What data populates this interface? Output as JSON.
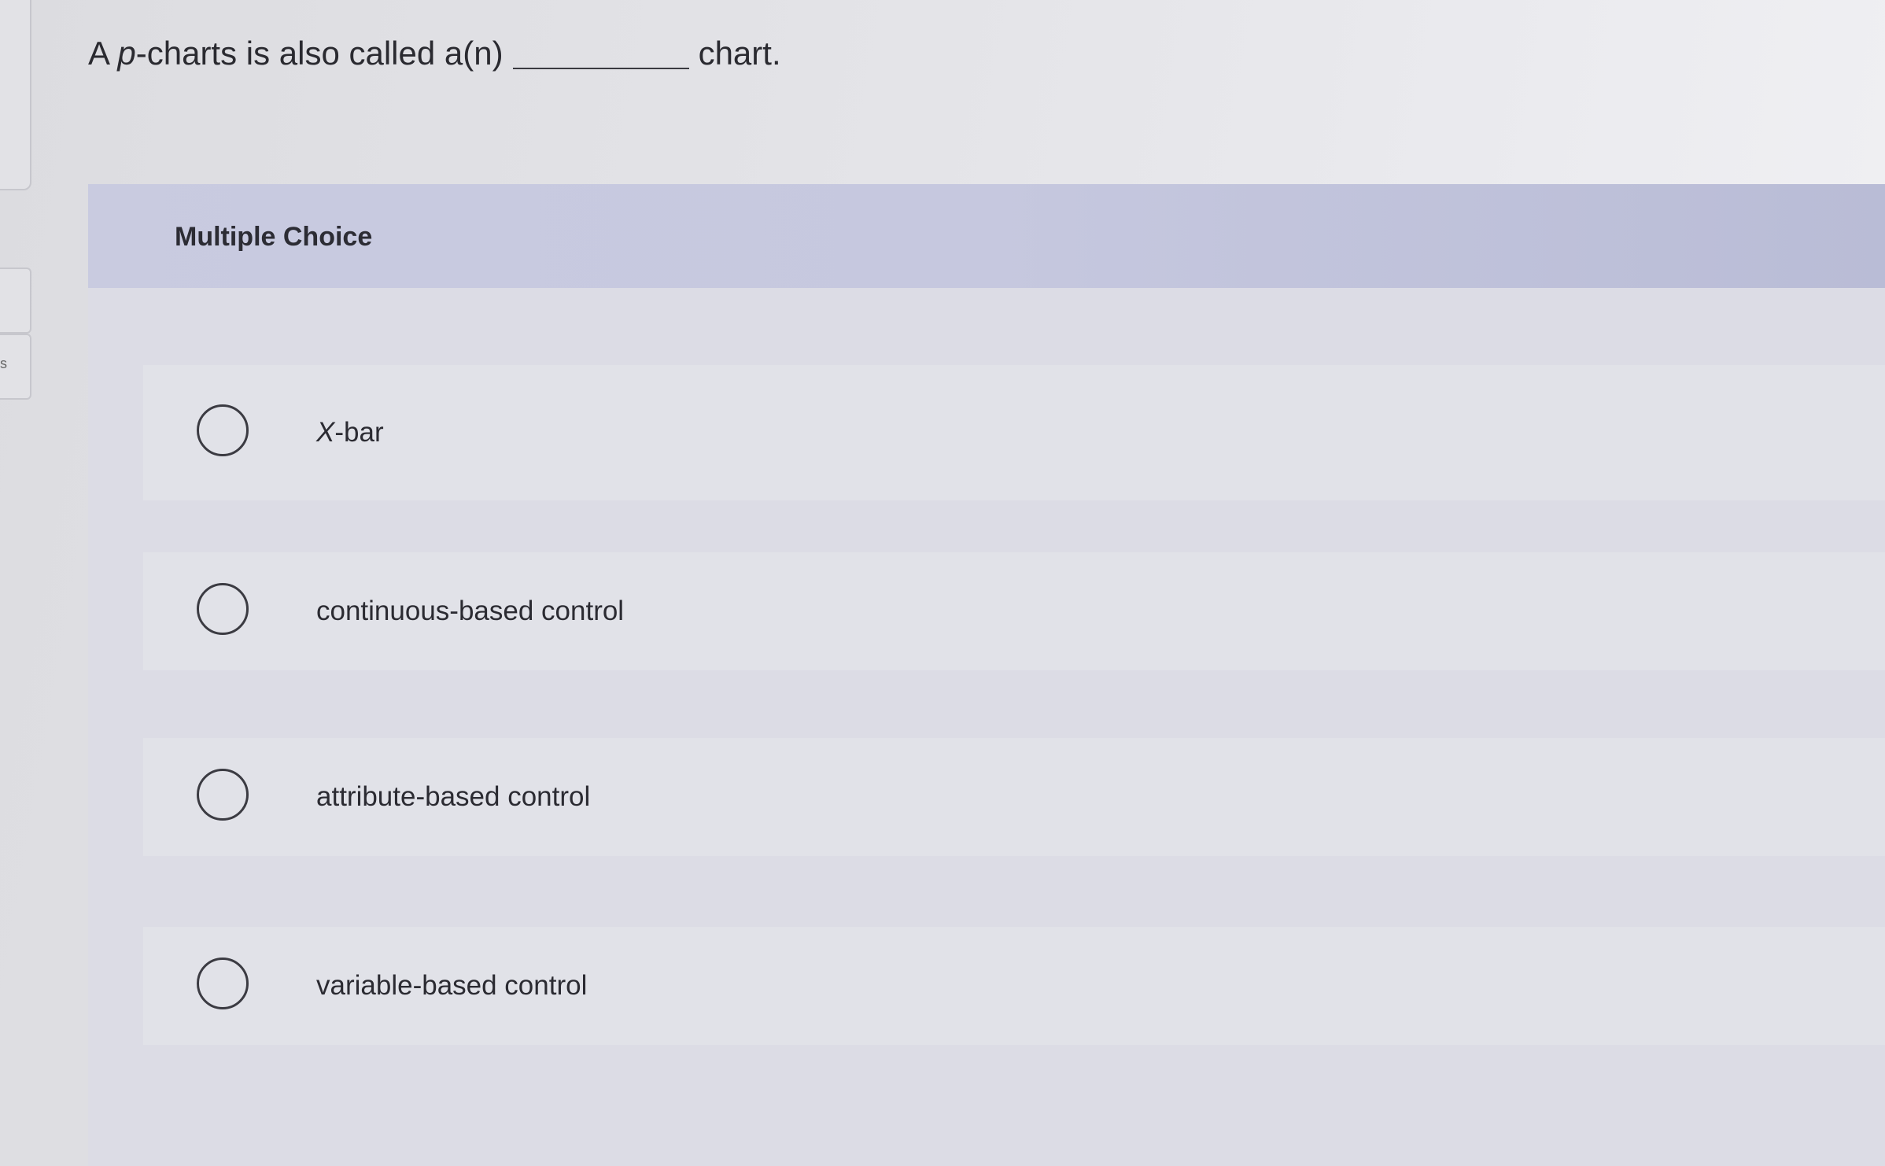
{
  "question": {
    "prefix": "A ",
    "variable": "p",
    "middle": "-charts is also called a(n)",
    "suffix": "chart."
  },
  "left_edge": {
    "letter": "s"
  },
  "multiple_choice": {
    "title": "Multiple Choice",
    "options": [
      {
        "label": "X-bar",
        "selected": false
      },
      {
        "label": "continuous-based control",
        "selected": false
      },
      {
        "label": "attribute-based control",
        "selected": false
      },
      {
        "label": "variable-based control",
        "selected": false
      }
    ]
  }
}
